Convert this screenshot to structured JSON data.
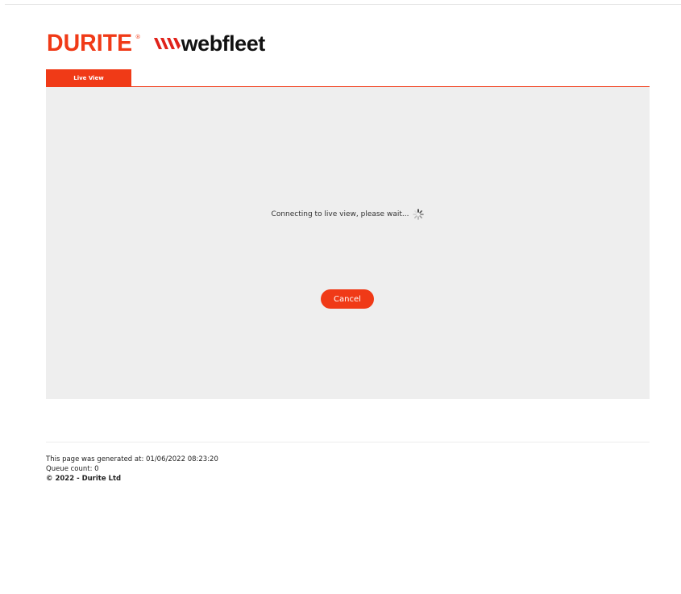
{
  "brand": {
    "durite_logo_text": "DURITE",
    "durite_registered": "®",
    "webfleet_logo_text": "webfleet"
  },
  "tabs": [
    {
      "label": "Live View",
      "active": true
    }
  ],
  "live_view": {
    "status_text": "Connecting to live view, please wait...",
    "cancel_label": "Cancel"
  },
  "footer": {
    "generated_text": "This page was generated at: 01/06/2022 08:23:20",
    "queue_text": "Queue count: 0",
    "copyright_text": "© 2022 - Durite Ltd"
  },
  "colors": {
    "accent": "#f03a17",
    "panel_bg": "#eeeeee"
  }
}
